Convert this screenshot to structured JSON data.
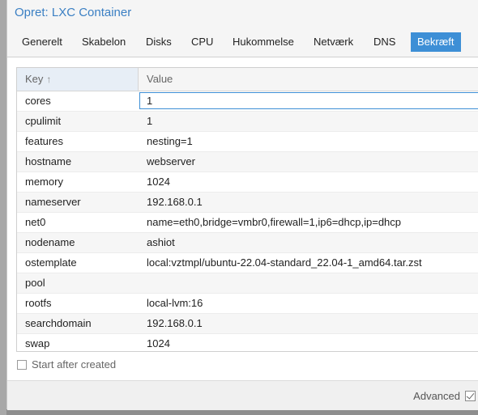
{
  "window": {
    "title": "Opret: LXC Container"
  },
  "tabs": [
    {
      "label": "Generelt",
      "active": false
    },
    {
      "label": "Skabelon",
      "active": false
    },
    {
      "label": "Disks",
      "active": false
    },
    {
      "label": "CPU",
      "active": false
    },
    {
      "label": "Hukommelse",
      "active": false
    },
    {
      "label": "Netværk",
      "active": false
    },
    {
      "label": "DNS",
      "active": false
    },
    {
      "label": "Bekræft",
      "active": true
    }
  ],
  "grid": {
    "columns": {
      "key": "Key",
      "value": "Value"
    },
    "sort_icon": "arrow-up-icon",
    "rows": [
      {
        "key": "cores",
        "value": "1"
      },
      {
        "key": "cpulimit",
        "value": "1"
      },
      {
        "key": "features",
        "value": "nesting=1"
      },
      {
        "key": "hostname",
        "value": "webserver"
      },
      {
        "key": "memory",
        "value": "1024"
      },
      {
        "key": "nameserver",
        "value": "192.168.0.1"
      },
      {
        "key": "net0",
        "value": "name=eth0,bridge=vmbr0,firewall=1,ip6=dhcp,ip=dhcp"
      },
      {
        "key": "nodename",
        "value": "ashiot"
      },
      {
        "key": "ostemplate",
        "value": "local:vztmpl/ubuntu-22.04-standard_22.04-1_amd64.tar.zst"
      },
      {
        "key": "pool",
        "value": ""
      },
      {
        "key": "rootfs",
        "value": "local-lvm:16"
      },
      {
        "key": "searchdomain",
        "value": "192.168.0.1"
      },
      {
        "key": "swap",
        "value": "1024"
      }
    ]
  },
  "options": {
    "start_after_created": "Start after created",
    "start_after_created_checked": false
  },
  "footer": {
    "advanced_label": "Advanced",
    "advanced_checked": true
  },
  "colors": {
    "accent": "#3d8fd6",
    "title": "#3a7fc3"
  }
}
